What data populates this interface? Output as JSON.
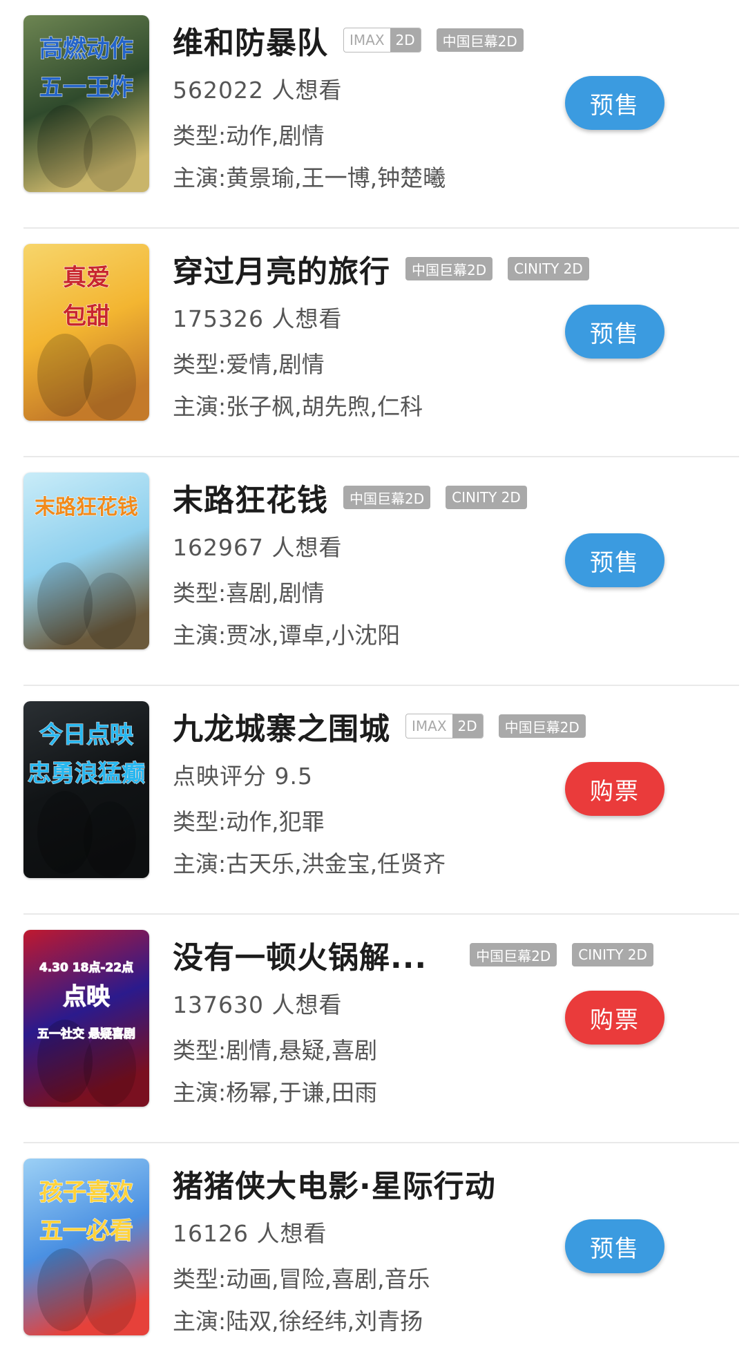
{
  "colors": {
    "presale": "#3b9be0",
    "buy": "#ea3b3b",
    "tag_gray": "#a9a9a9"
  },
  "movies": [
    {
      "title": "维和防暴队",
      "tags": [
        {
          "type": "imax",
          "a": "IMAX",
          "b": "2D"
        },
        {
          "type": "plain",
          "text": "中国巨幕2D"
        }
      ],
      "stat": "562022 人想看",
      "genre": "类型:动作,剧情",
      "cast": "主演:黄景瑜,王一博,钟楚曦",
      "button": "预售",
      "button_kind": "presale",
      "poster_text": [
        "高燃动作",
        "五一王炸"
      ],
      "poster_colors": [
        "#2f4a2c",
        "#6d8552",
        "#c9b56a"
      ],
      "poster_text_color": "#2464c9"
    },
    {
      "title": "穿过月亮的旅行",
      "tags": [
        {
          "type": "plain",
          "text": "中国巨幕2D"
        },
        {
          "type": "plain",
          "text": "CINITY 2D"
        }
      ],
      "stat": "175326 人想看",
      "genre": "类型:爱情,剧情",
      "cast": "主演:张子枫,胡先煦,仁科",
      "button": "预售",
      "button_kind": "presale",
      "poster_text": [
        "真爱",
        "包甜"
      ],
      "poster_colors": [
        "#f3b531",
        "#f7d56b",
        "#c47a29"
      ],
      "poster_text_color": "#c8262e"
    },
    {
      "title": "末路狂花钱",
      "tags": [
        {
          "type": "plain",
          "text": "中国巨幕2D"
        },
        {
          "type": "plain",
          "text": "CINITY 2D"
        }
      ],
      "stat": "162967 人想看",
      "genre": "类型:喜剧,剧情",
      "cast": "主演:贾冰,谭卓,小沈阳",
      "button": "预售",
      "button_kind": "presale",
      "poster_text": [
        "末路狂花钱"
      ],
      "poster_colors": [
        "#8fd0ee",
        "#c9ecf8",
        "#6b5a3c"
      ],
      "poster_text_color": "#f08a1c"
    },
    {
      "title": "九龙城寨之围城",
      "tags": [
        {
          "type": "imax",
          "a": "IMAX",
          "b": "2D"
        },
        {
          "type": "plain",
          "text": "中国巨幕2D"
        }
      ],
      "stat": "点映评分 9.5",
      "genre": "类型:动作,犯罪",
      "cast": "主演:古天乐,洪金宝,任贤齐",
      "button": "购票",
      "button_kind": "buy",
      "poster_text": [
        "今日点映",
        "忠勇浪猛癫"
      ],
      "poster_colors": [
        "#111416",
        "#2a2f33",
        "#0d0f10"
      ],
      "poster_text_color": "#27b7f0"
    },
    {
      "title": "没有一顿火锅解...",
      "tags": [
        {
          "type": "plain",
          "text": "中国巨幕2D"
        },
        {
          "type": "plain",
          "text": "CINITY 2D"
        }
      ],
      "stat": "137630 人想看",
      "genre": "类型:剧情,悬疑,喜剧",
      "cast": "主演:杨幂,于谦,田雨",
      "button": "购票",
      "button_kind": "buy",
      "poster_text": [
        "4.30 18点-22点",
        "点映",
        "五一社交 悬疑喜剧"
      ],
      "poster_colors": [
        "#2b1a8c",
        "#c0192f",
        "#7a1020"
      ],
      "poster_text_color": "#ffffff"
    },
    {
      "title": "猪猪侠大电影·星际行动",
      "tags": [],
      "stat": "16126 人想看",
      "genre": "类型:动画,冒险,喜剧,音乐",
      "cast": "主演:陆双,徐经纬,刘青扬",
      "button": "预售",
      "button_kind": "presale",
      "poster_text": [
        "孩子喜欢",
        "五一必看"
      ],
      "poster_colors": [
        "#4a90e2",
        "#9cd0f5",
        "#e6413a"
      ],
      "poster_text_color": "#ffd23a"
    }
  ]
}
